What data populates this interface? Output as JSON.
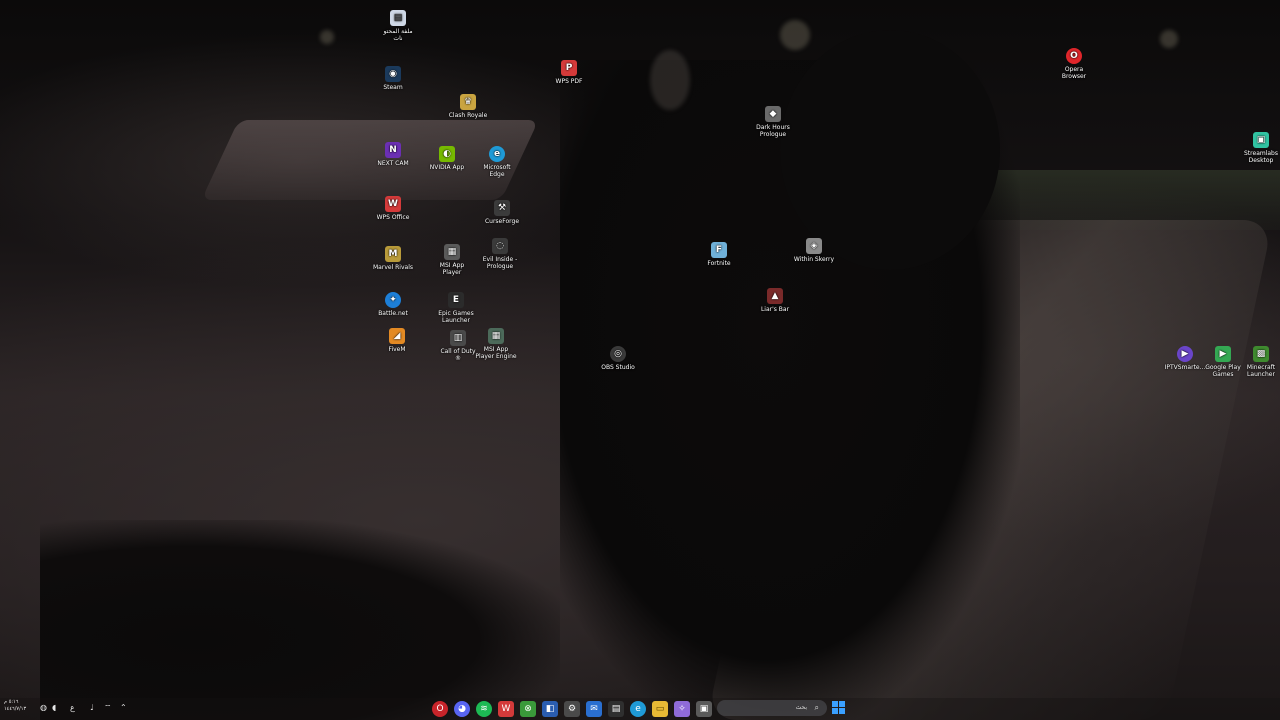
{
  "desktop": {
    "icons": [
      {
        "label": "ملفة المحتو\nنات",
        "icon": "document-icon",
        "color": "#cfd8e6",
        "glyph": "▤"
      },
      {
        "label": "Steam",
        "icon": "steam-icon",
        "color": "#1b3a5c",
        "glyph": "◉"
      },
      {
        "label": "WPS PDF",
        "icon": "wps-pdf-icon",
        "color": "#d43a3a",
        "glyph": "P"
      },
      {
        "label": "Clash Royale",
        "icon": "clash-royale-icon",
        "color": "#c9a440",
        "glyph": "♛"
      },
      {
        "label": "Opera\nBrowser",
        "icon": "opera-icon",
        "color": "#e0262b",
        "glyph": "O"
      },
      {
        "label": "Dark Hours\nPrologue",
        "icon": "dark-hours-icon",
        "color": "#6a6a6a",
        "glyph": "◆"
      },
      {
        "label": "Streamlabs\nDesktop",
        "icon": "streamlabs-icon",
        "color": "#31c3a2",
        "glyph": "▣"
      },
      {
        "label": "NEXT CAM",
        "icon": "next-cam-icon",
        "color": "#6b2fb3",
        "glyph": "N"
      },
      {
        "label": "NVIDIA App",
        "icon": "nvidia-icon",
        "color": "#76b900",
        "glyph": "◐"
      },
      {
        "label": "Microsoft\nEdge",
        "icon": "edge-icon",
        "color": "#1f9ad6",
        "glyph": "e"
      },
      {
        "label": "WPS Office",
        "icon": "wps-office-icon",
        "color": "#d43a3a",
        "glyph": "W"
      },
      {
        "label": "CurseForge",
        "icon": "curseforge-icon",
        "color": "#3b3b3b",
        "glyph": "⚒"
      },
      {
        "label": "Marvel Rivals",
        "icon": "marvel-rivals-icon",
        "color": "#b99b3a",
        "glyph": "M"
      },
      {
        "label": "MSI App\nPlayer",
        "icon": "msi-app-player-icon",
        "color": "#5a5a5a",
        "glyph": "▦"
      },
      {
        "label": "Evil Inside -\nPrologue",
        "icon": "evil-inside-icon",
        "color": "#3a3a3a",
        "glyph": "◌"
      },
      {
        "label": "Fortnite",
        "icon": "fortnite-icon",
        "color": "#6fb0d8",
        "glyph": "F"
      },
      {
        "label": "Within Skerry",
        "icon": "within-skerry-icon",
        "color": "#8a8a8a",
        "glyph": "◈"
      },
      {
        "label": "Battle.net",
        "icon": "battle-net-icon",
        "color": "#1d7fd8",
        "glyph": "✦"
      },
      {
        "label": "Epic Games\nLauncher",
        "icon": "epic-games-icon",
        "color": "#2b2b2b",
        "glyph": "E"
      },
      {
        "label": "Liar's Bar",
        "icon": "liars-bar-icon",
        "color": "#7a2a2a",
        "glyph": "▲"
      },
      {
        "label": "FiveM",
        "icon": "fivem-icon",
        "color": "#e38a24",
        "glyph": "◢"
      },
      {
        "label": "Call of Duty\n®",
        "icon": "call-of-duty-icon",
        "color": "#4a4a4a",
        "glyph": "▥"
      },
      {
        "label": "MSI App\nPlayer Engine",
        "icon": "msi-app-player-engine-icon",
        "color": "#4c6a5a",
        "glyph": "▦"
      },
      {
        "label": "OBS Studio",
        "icon": "obs-studio-icon",
        "color": "#3a3a3a",
        "glyph": "◎"
      },
      {
        "label": "IPTVSmarte...",
        "icon": "iptv-smarters-icon",
        "color": "#6a45c9",
        "glyph": "▶"
      },
      {
        "label": "Google Play\nGames",
        "icon": "google-play-games-icon",
        "color": "#34a853",
        "glyph": "▶"
      },
      {
        "label": "Minecraft\nLauncher",
        "icon": "minecraft-launcher-icon",
        "color": "#3f8a2f",
        "glyph": "▩"
      }
    ]
  },
  "taskbar": {
    "apps": [
      {
        "name": "Opera",
        "icon": "opera-icon",
        "color": "#c8242a",
        "glyph": "O",
        "active": true
      },
      {
        "name": "Discord",
        "icon": "discord-icon",
        "color": "#5865f2",
        "glyph": "◕",
        "active": false
      },
      {
        "name": "Spotify",
        "icon": "spotify-icon",
        "color": "#1db954",
        "glyph": "≋",
        "active": false
      },
      {
        "name": "WPS Office",
        "icon": "wps-office-icon",
        "color": "#d43a3a",
        "glyph": "W",
        "active": false
      },
      {
        "name": "Xbox",
        "icon": "xbox-icon",
        "color": "#3a9a3a",
        "glyph": "⊗",
        "active": false
      },
      {
        "name": "Security",
        "icon": "shield-icon",
        "color": "#2a5db0",
        "glyph": "◧",
        "active": false
      },
      {
        "name": "Settings",
        "icon": "gear-icon",
        "color": "#4a4a4a",
        "glyph": "⚙",
        "active": false
      },
      {
        "name": "Mail",
        "icon": "mail-icon",
        "color": "#2a6fd0",
        "glyph": "✉",
        "active": false
      },
      {
        "name": "Store",
        "icon": "store-icon",
        "color": "#2f2f2f",
        "glyph": "▤",
        "active": false
      },
      {
        "name": "Microsoft Edge",
        "icon": "edge-icon",
        "color": "#1f9ad6",
        "glyph": "e",
        "active": false
      },
      {
        "name": "File Explorer",
        "icon": "folder-icon",
        "color": "#e7b935",
        "glyph": "▭",
        "active": false
      },
      {
        "name": "Copilot",
        "icon": "copilot-icon",
        "color": "#8f6bd8",
        "glyph": "✧",
        "active": false
      },
      {
        "name": "Task View",
        "icon": "task-view-icon",
        "color": "#5a5a5a",
        "glyph": "▣",
        "active": false
      }
    ],
    "search_placeholder": "بحث",
    "clock_time": "٥:١٦ م",
    "clock_date": "١٤٤٦/٧/١٣"
  }
}
